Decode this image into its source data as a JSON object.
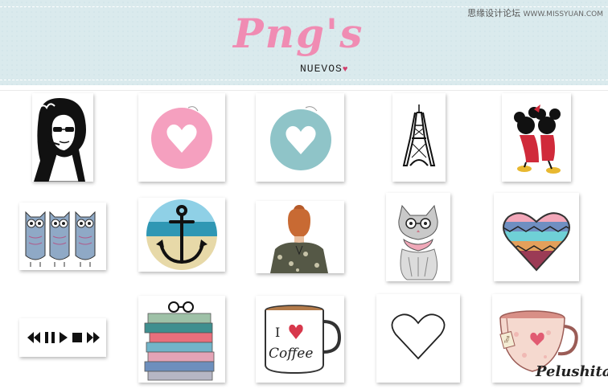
{
  "header": {
    "title": "Png's",
    "subtitle": "NUEVOS",
    "subtitle_heart": "♥",
    "watermark_cn": "思缘设计论坛",
    "watermark_url": "WWW.MISSYUAN.COM"
  },
  "gallery": {
    "items": [
      {
        "name": "woman-sunglasses-image",
        "icon": "woman-sunglasses"
      },
      {
        "name": "pink-heart-circle-image",
        "icon": "heart-circle",
        "color": "#f5a0bf"
      },
      {
        "name": "blue-heart-circle-image",
        "icon": "heart-circle",
        "color": "#8fc4c8"
      },
      {
        "name": "eiffel-tower-image",
        "icon": "eiffel-tower"
      },
      {
        "name": "mickey-minnie-image",
        "icon": "mickey-minnie"
      },
      {
        "name": "owls-image",
        "icon": "owls"
      },
      {
        "name": "anchor-beach-circle-image",
        "icon": "anchor"
      },
      {
        "name": "girl-back-bun-image",
        "icon": "girl-bun"
      },
      {
        "name": "cat-glasses-image",
        "icon": "cat"
      },
      {
        "name": "tribal-heart-image",
        "icon": "tribal-heart"
      },
      {
        "name": "media-controls-image",
        "icon": "media-controls"
      },
      {
        "name": "books-glasses-image",
        "icon": "books"
      },
      {
        "name": "coffee-mug-image",
        "icon": "coffee-mug",
        "text_line1": "I",
        "text_line2": "Coffee"
      },
      {
        "name": "outline-heart-image",
        "icon": "outline-heart"
      },
      {
        "name": "tea-cup-image",
        "icon": "tea-cup",
        "tag": "Tea"
      }
    ]
  },
  "signature": {
    "text": "Pelushita",
    "heart": "♥"
  }
}
